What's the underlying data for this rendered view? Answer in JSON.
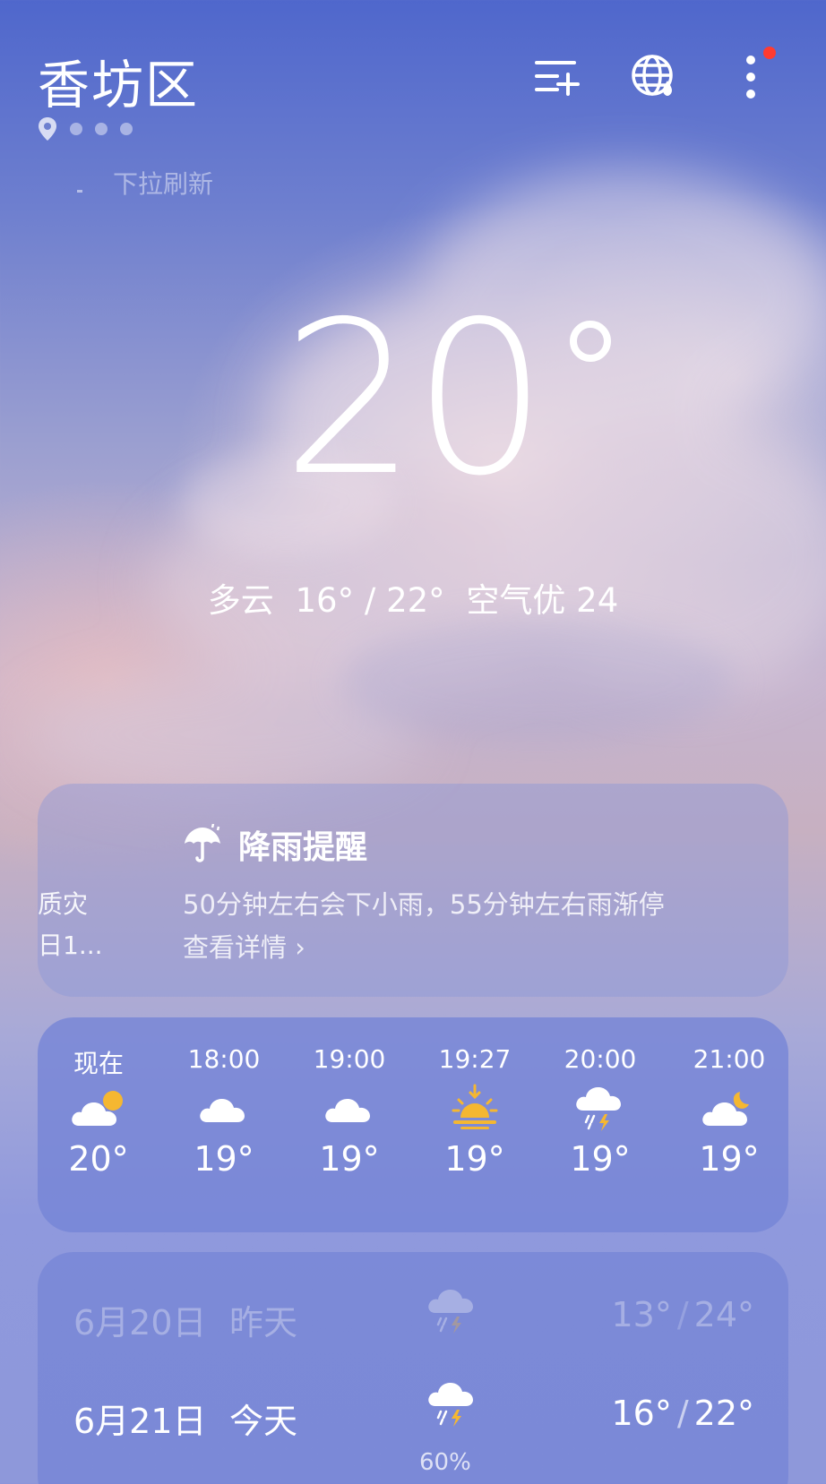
{
  "header": {
    "city": "香坊区",
    "pull_hint": "下拉刷新",
    "icons": [
      "add-city-icon",
      "globe-weather-icon",
      "more-vert-icon"
    ],
    "has_notification_badge": true
  },
  "current": {
    "temperature": "20",
    "condition": "多云",
    "range": "16° / 22°",
    "air_quality": "空气优 24"
  },
  "rain_alert": {
    "side_text_1": "质灾",
    "side_text_2": "日1...",
    "title": "降雨提醒",
    "description": "50分钟左右会下小雨，55分钟左右雨渐停",
    "more_link": "查看详情"
  },
  "hourly": [
    {
      "time": "现在",
      "icon": "partly-cloudy-icon",
      "temp": "20°"
    },
    {
      "time": "18:00",
      "icon": "cloudy-icon",
      "temp": "19°"
    },
    {
      "time": "19:00",
      "icon": "cloudy-icon",
      "temp": "19°"
    },
    {
      "time": "19:27",
      "icon": "sunset-icon",
      "temp": "19°"
    },
    {
      "time": "20:00",
      "icon": "thunder-rain-icon",
      "temp": "19°"
    },
    {
      "time": "21:00",
      "icon": "partly-cloudy-icon",
      "temp": "19°"
    }
  ],
  "daily": [
    {
      "date": "6月20日",
      "label": "昨天",
      "icon": "thunder-rain-icon",
      "low": "13°",
      "high": "24°"
    },
    {
      "date": "6月21日",
      "label": "今天",
      "icon": "thunder-rain-icon",
      "low": "16°",
      "high": "22°",
      "precip": "60%"
    }
  ],
  "colors": {
    "sun": "#f5b731",
    "badge": "#ff3b30"
  }
}
